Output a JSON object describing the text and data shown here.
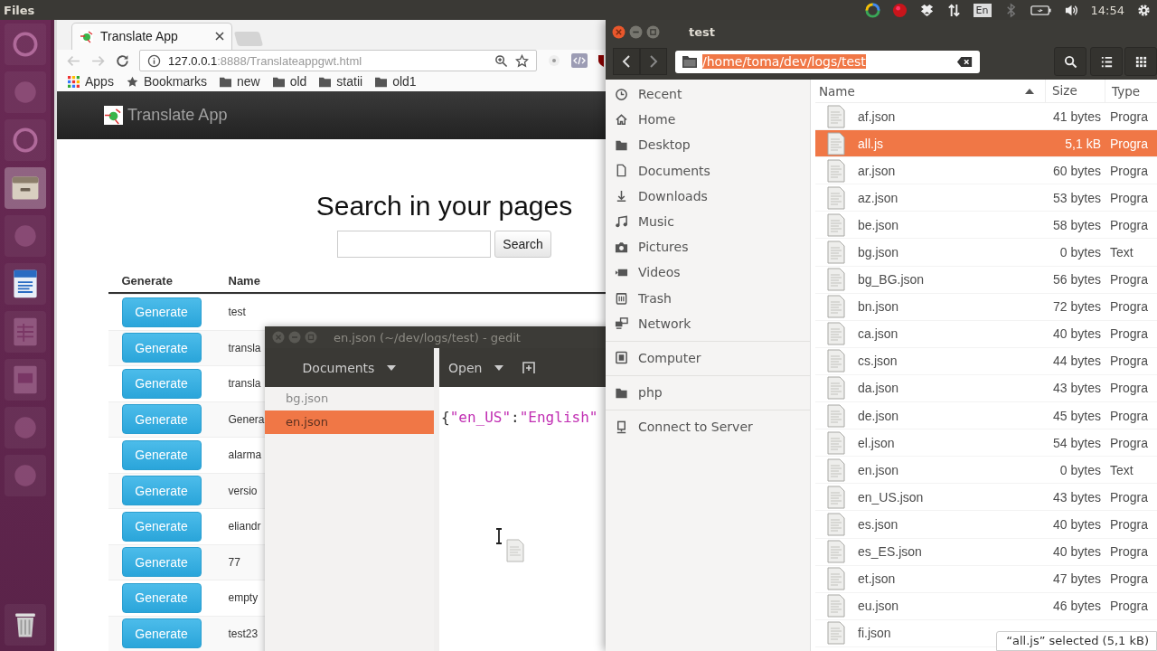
{
  "top_panel": {
    "app_name": "Files",
    "keyboard_layout": "En",
    "time": "14:54"
  },
  "launcher": {
    "items": [
      {
        "kind": "dash",
        "selected": false
      },
      {
        "kind": "app",
        "selected": false
      },
      {
        "kind": "dash",
        "selected": false
      },
      {
        "kind": "files",
        "selected": true
      },
      {
        "kind": "app",
        "selected": false
      },
      {
        "kind": "writer",
        "selected": false
      },
      {
        "kind": "calc",
        "selected": false
      },
      {
        "kind": "impress",
        "selected": false
      },
      {
        "kind": "app",
        "selected": false
      },
      {
        "kind": "app",
        "selected": false
      },
      {
        "kind": "trash",
        "selected": false
      }
    ]
  },
  "browser": {
    "tab_title": "Translate App",
    "url_host": "127.0.0.1",
    "url_path": ":8888/Translateappgwt.html",
    "bookmarks": [
      {
        "kind": "apps",
        "label": "Apps"
      },
      {
        "kind": "star",
        "label": "Bookmarks"
      },
      {
        "kind": "folder",
        "label": "new"
      },
      {
        "kind": "folder",
        "label": "old"
      },
      {
        "kind": "folder",
        "label": "statii"
      },
      {
        "kind": "folder",
        "label": "old1"
      }
    ],
    "page": {
      "brand": "Translate App",
      "heading": "Search in your pages",
      "search_button": "Search",
      "table": {
        "columns": [
          "Generate",
          "Name"
        ],
        "rows": [
          {
            "button": "Generate",
            "name": "test"
          },
          {
            "button": "Generate",
            "name": "transla"
          },
          {
            "button": "Generate",
            "name": "transla"
          },
          {
            "button": "Generate",
            "name": "Genera"
          },
          {
            "button": "Generate",
            "name": "alarma"
          },
          {
            "button": "Generate",
            "name": "versio"
          },
          {
            "button": "Generate",
            "name": "eliandr"
          },
          {
            "button": "Generate",
            "name": "77"
          },
          {
            "button": "Generate",
            "name": "empty"
          },
          {
            "button": "Generate",
            "name": "test23"
          }
        ]
      }
    }
  },
  "gedit": {
    "title": "en.json (~/dev/logs/test) - gedit",
    "documents_button": "Documents",
    "open_button": "Open",
    "documents": [
      {
        "name": "bg.json",
        "selected": false
      },
      {
        "name": "en.json",
        "selected": true
      }
    ],
    "line_tokens": [
      {
        "kind": "punct",
        "text": "{"
      },
      {
        "kind": "string",
        "text": "\"en_US\""
      },
      {
        "kind": "punct",
        "text": ":"
      },
      {
        "kind": "string",
        "text": "\"English\""
      }
    ]
  },
  "files": {
    "title": "test",
    "path": "/home/toma/dev/logs/test",
    "sidebar_sections": [
      {
        "items": [
          {
            "kind": "recent",
            "label": "Recent"
          },
          {
            "kind": "home",
            "label": "Home"
          },
          {
            "kind": "folder",
            "label": "Desktop"
          },
          {
            "kind": "document",
            "label": "Documents"
          },
          {
            "kind": "download",
            "label": "Downloads"
          },
          {
            "kind": "music",
            "label": "Music"
          },
          {
            "kind": "camera",
            "label": "Pictures"
          },
          {
            "kind": "video",
            "label": "Videos"
          },
          {
            "kind": "trash",
            "label": "Trash"
          },
          {
            "kind": "network",
            "label": "Network"
          }
        ]
      },
      {
        "items": [
          {
            "kind": "computer",
            "label": "Computer"
          }
        ]
      },
      {
        "items": [
          {
            "kind": "folder",
            "label": "php"
          }
        ]
      },
      {
        "items": [
          {
            "kind": "server",
            "label": "Connect to Server"
          }
        ]
      }
    ],
    "columns": {
      "name": "Name",
      "size": "Size",
      "type": "Type"
    },
    "rows": [
      {
        "name": "af.json",
        "size": "41 bytes",
        "type": "Progra",
        "selected": false
      },
      {
        "name": "all.js",
        "size": "5,1 kB",
        "type": "Progra",
        "selected": true
      },
      {
        "name": "ar.json",
        "size": "60 bytes",
        "type": "Progra",
        "selected": false
      },
      {
        "name": "az.json",
        "size": "53 bytes",
        "type": "Progra",
        "selected": false
      },
      {
        "name": "be.json",
        "size": "58 bytes",
        "type": "Progra",
        "selected": false
      },
      {
        "name": "bg.json",
        "size": "0 bytes",
        "type": "Text",
        "selected": false
      },
      {
        "name": "bg_BG.json",
        "size": "56 bytes",
        "type": "Progra",
        "selected": false
      },
      {
        "name": "bn.json",
        "size": "72 bytes",
        "type": "Progra",
        "selected": false
      },
      {
        "name": "ca.json",
        "size": "40 bytes",
        "type": "Progra",
        "selected": false
      },
      {
        "name": "cs.json",
        "size": "44 bytes",
        "type": "Progra",
        "selected": false
      },
      {
        "name": "da.json",
        "size": "43 bytes",
        "type": "Progra",
        "selected": false
      },
      {
        "name": "de.json",
        "size": "45 bytes",
        "type": "Progra",
        "selected": false
      },
      {
        "name": "el.json",
        "size": "54 bytes",
        "type": "Progra",
        "selected": false
      },
      {
        "name": "en.json",
        "size": "0 bytes",
        "type": "Text",
        "selected": false
      },
      {
        "name": "en_US.json",
        "size": "43 bytes",
        "type": "Progra",
        "selected": false
      },
      {
        "name": "es.json",
        "size": "40 bytes",
        "type": "Progra",
        "selected": false
      },
      {
        "name": "es_ES.json",
        "size": "40 bytes",
        "type": "Progra",
        "selected": false
      },
      {
        "name": "et.json",
        "size": "47 bytes",
        "type": "Progra",
        "selected": false
      },
      {
        "name": "eu.json",
        "size": "46 bytes",
        "type": "Progra",
        "selected": false
      },
      {
        "name": "fi.json",
        "selected": false
      }
    ],
    "status": "“all.js” selected (5,1 kB)"
  }
}
